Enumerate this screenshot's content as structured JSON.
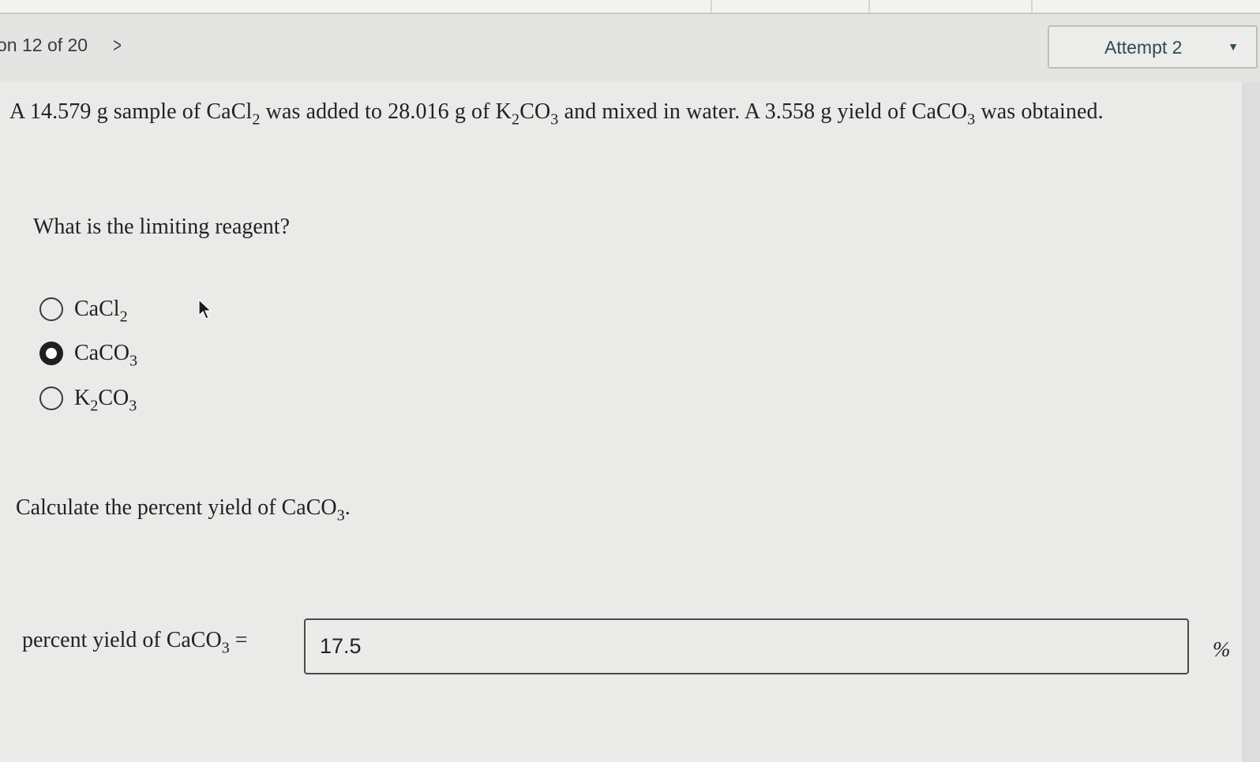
{
  "header": {
    "question_counter": "on 12 of 20",
    "next_symbol": ">",
    "attempt_label": "Attempt 2",
    "attempt_caret": "▼"
  },
  "problem": {
    "part1": "A 14.579 g sample of CaCl",
    "sub1": "2",
    "part2": " was added to 28.016 g of K",
    "sub2": "2",
    "part3": "CO",
    "sub3": "3",
    "part4": " and mixed in water. A 3.558 g yield of CaCO",
    "sub4": "3",
    "part5": " was obtained."
  },
  "question1": "What is the limiting reagent?",
  "options": [
    {
      "main": "CaCl",
      "sub": "2",
      "selected": false
    },
    {
      "main": "CaCO",
      "sub": "3",
      "selected": true
    },
    {
      "pre": "K",
      "pre_sub": "2",
      "main": "CO",
      "sub": "3",
      "selected": false
    }
  ],
  "question2": {
    "text": "Calculate the percent yield of CaCO",
    "sub": "3",
    "end": "."
  },
  "answer": {
    "label": "percent yield of CaCO",
    "label_sub": "3",
    "equals": " =",
    "value": "17.5",
    "unit": "%"
  },
  "colors": {
    "background": "#eaeae8",
    "header_background": "#e4e4e2",
    "accent_text": "#2f4b55"
  }
}
